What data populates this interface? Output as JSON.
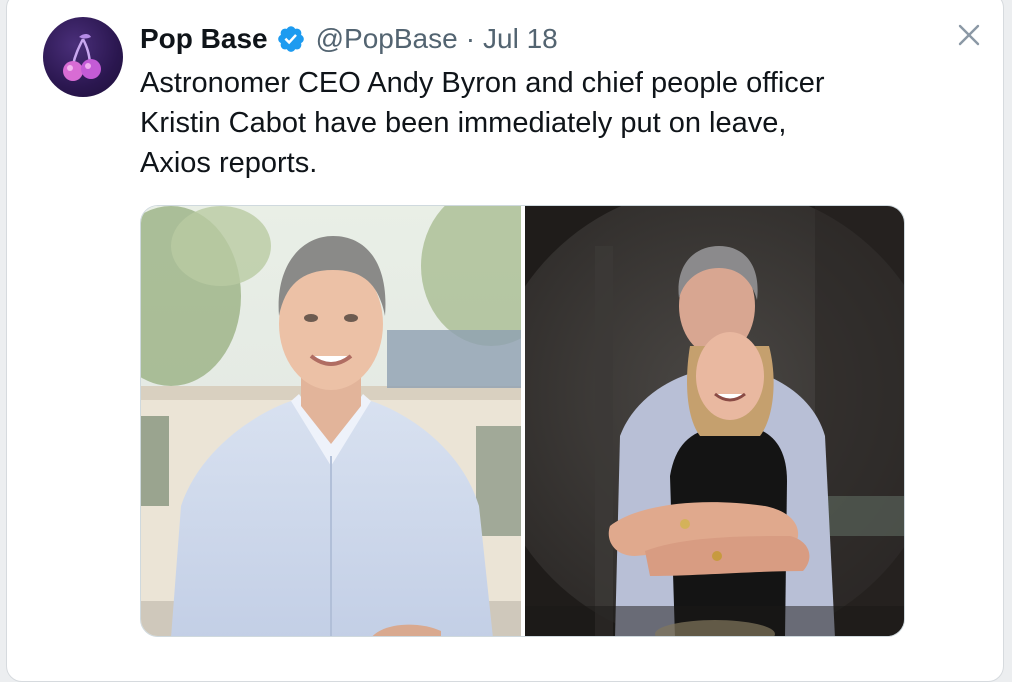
{
  "tweet": {
    "author": {
      "display_name": "Pop Base",
      "handle": "@PopBase",
      "verified": true,
      "avatar_icon": "cherry-icon"
    },
    "separator": "·",
    "date": "Jul 18",
    "text_lines": [
      "Astronomer CEO Andy Byron and chief people officer",
      "Kristin Cabot have been immediately put on leave,",
      "Axios reports."
    ],
    "media": [
      {
        "name": "photo-headshot",
        "icon": "photo"
      },
      {
        "name": "photo-concert-kiss-cam",
        "icon": "photo"
      }
    ]
  },
  "colors": {
    "verified_blue": "#1d9bf0",
    "text_primary": "#0f1419",
    "text_secondary": "#536471",
    "border": "#cfd9de"
  },
  "icons": {
    "close": "close-icon",
    "verified": "verified-badge-icon"
  }
}
